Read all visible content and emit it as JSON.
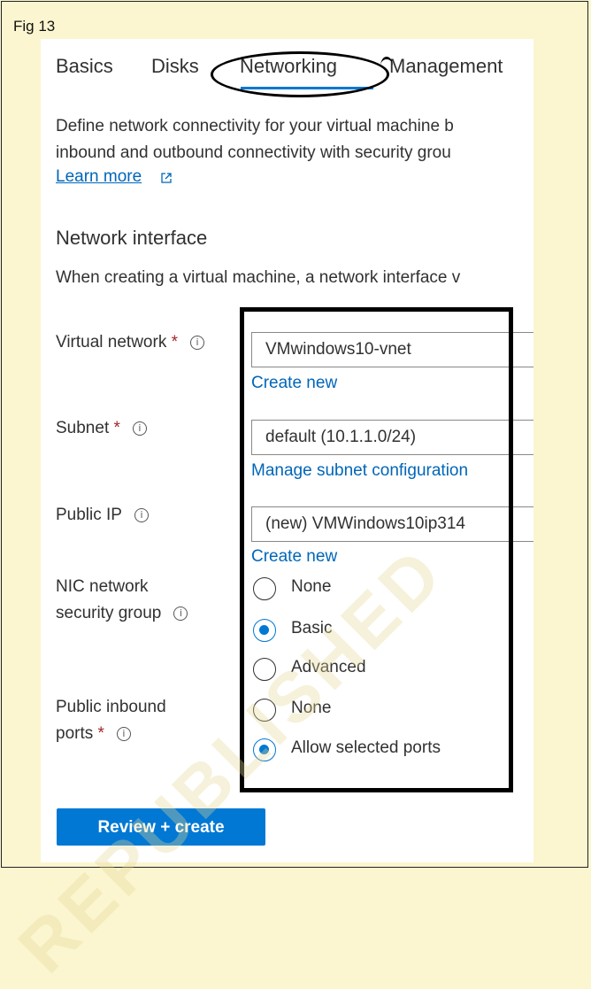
{
  "figure_label": "Fig 13",
  "tabs": [
    {
      "label": "Basics"
    },
    {
      "label": "Disks"
    },
    {
      "label": "Networking"
    },
    {
      "label": "Management"
    }
  ],
  "active_tab": "Networking",
  "description": {
    "line1": "Define network connectivity for your virtual machine b",
    "line2": "inbound and outbound connectivity with security grou",
    "learn_more": "Learn more"
  },
  "network_interface": {
    "title": "Network interface",
    "description": "When creating a virtual machine, a network interface v"
  },
  "fields": {
    "virtual_network": {
      "label": "Virtual network",
      "required": "*",
      "value": "VMwindows10-vnet",
      "link": "Create new"
    },
    "subnet": {
      "label": "Subnet",
      "required": "*",
      "value": "default (10.1.1.0/24)",
      "link": "Manage subnet configuration"
    },
    "public_ip": {
      "label": "Public IP",
      "value": "(new) VMWindows10ip314",
      "link": "Create new"
    },
    "nic_nsg": {
      "label_line1": "NIC network",
      "label_line2": "security group",
      "options": [
        "None",
        "Basic",
        "Advanced"
      ],
      "selected": "Basic"
    },
    "public_inbound_ports": {
      "label_line1": "Public inbound",
      "label_line2": "ports",
      "required": "*",
      "options": [
        "None",
        "Allow selected ports"
      ],
      "selected": "Allow selected ports"
    }
  },
  "review_button": "Review + create",
  "watermark": "REPUBLISHED",
  "colors": {
    "accent": "#0078d4",
    "link": "#0066b8",
    "required": "#a4262c",
    "background": "#fbf6d0"
  },
  "icons": [
    "info-icon",
    "external-link-icon"
  ]
}
